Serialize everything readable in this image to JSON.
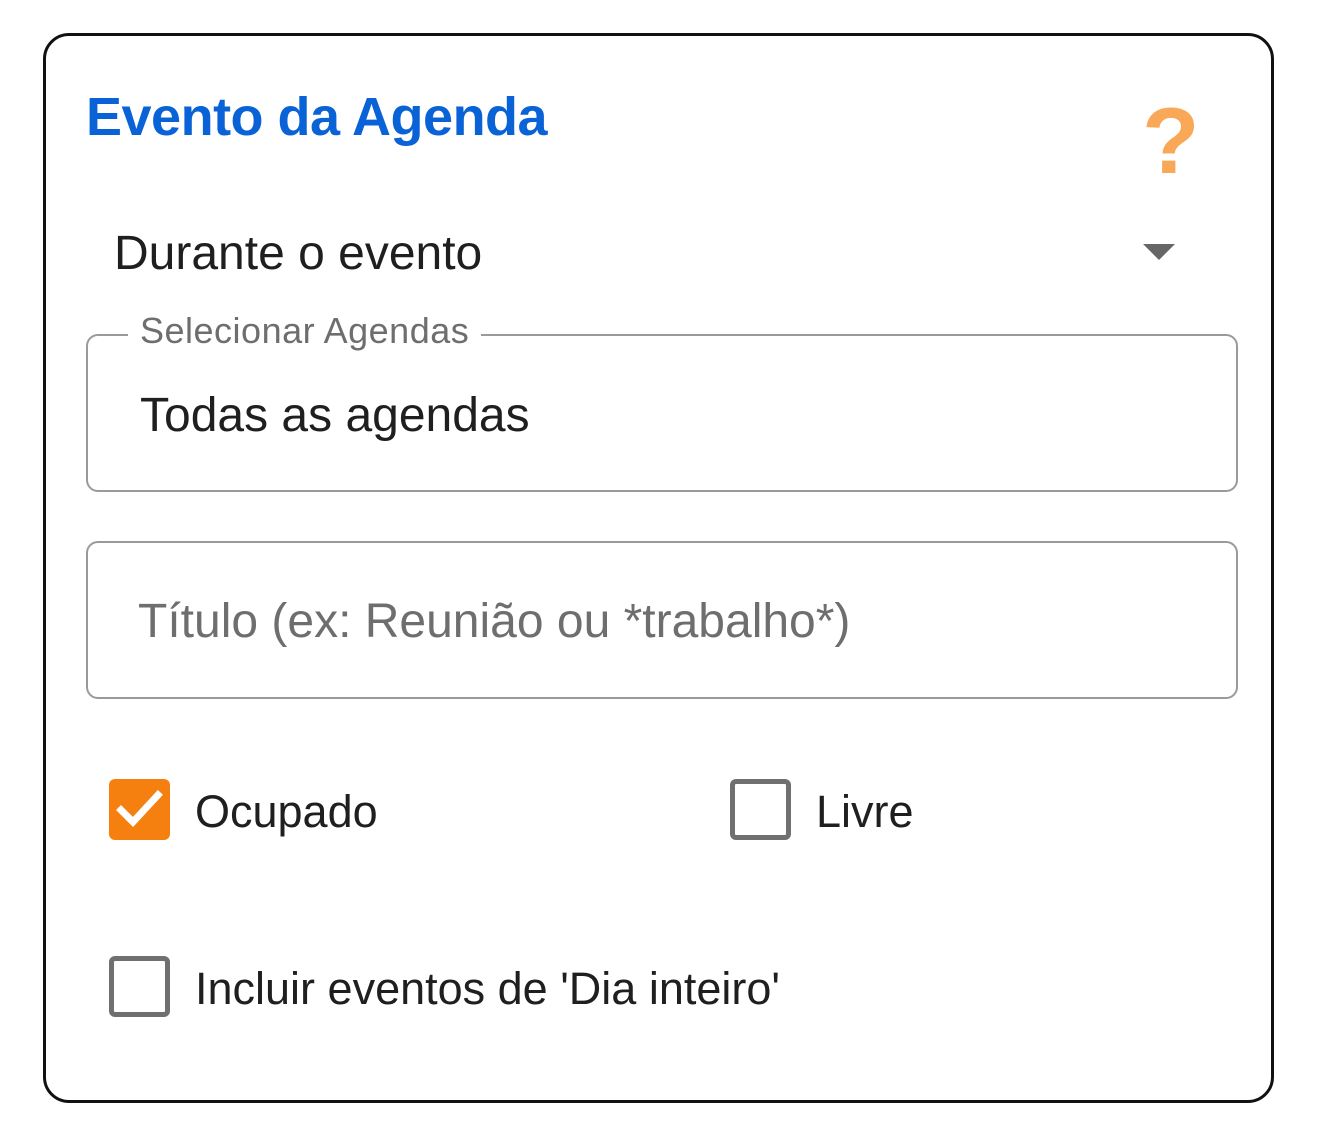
{
  "panel": {
    "title": "Evento da Agenda",
    "help_glyph": "?",
    "help_icon": "question-mark-icon",
    "accent_color": "#f5800f",
    "title_color": "#0a63d6"
  },
  "mode_select": {
    "selected": "Durante o evento",
    "caret_icon": "caret-down-icon"
  },
  "calendars_field": {
    "label": "Selecionar Agendas",
    "value": "Todas as agendas"
  },
  "title_field": {
    "value": "",
    "placeholder": "Título (ex: Reunião ou *trabalho*)"
  },
  "checkboxes": {
    "busy": {
      "label": "Ocupado",
      "checked": true
    },
    "free": {
      "label": "Livre",
      "checked": false
    },
    "all_day": {
      "label": "Incluir eventos de 'Dia inteiro'",
      "checked": false
    }
  }
}
